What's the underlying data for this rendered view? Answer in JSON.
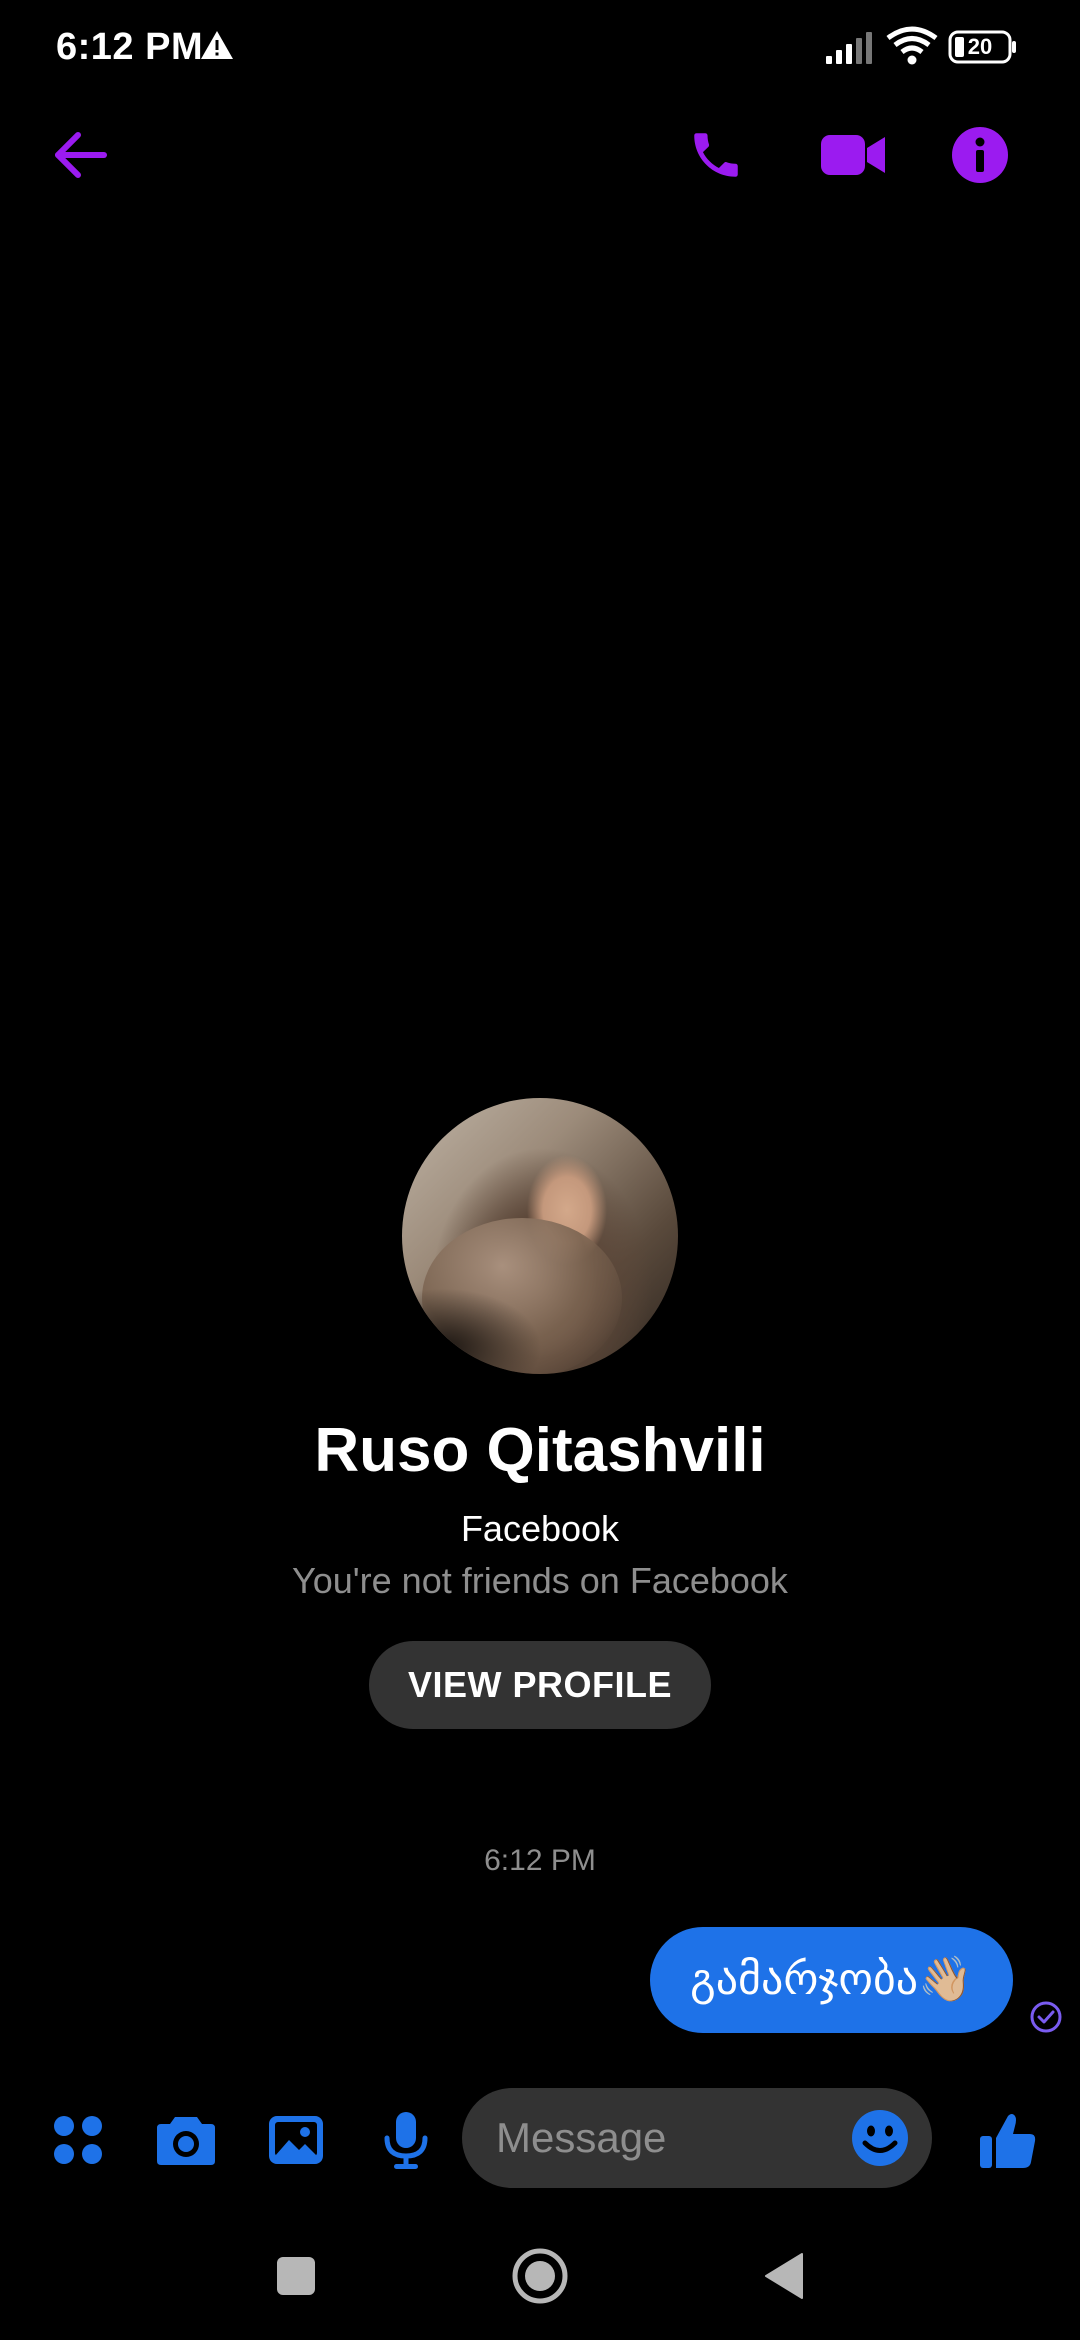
{
  "status_bar": {
    "time": "6:12 PM",
    "battery": "20",
    "icons": [
      "warning-icon",
      "signal-icon",
      "wifi-icon",
      "battery-icon"
    ]
  },
  "header": {
    "icons": [
      "back-arrow-icon",
      "phone-icon",
      "video-icon",
      "info-icon"
    ],
    "accent_color": "#9b1bf0"
  },
  "profile": {
    "name": "Ruso Qitashvili",
    "platform": "Facebook",
    "friend_status": "You're not friends on Facebook",
    "view_profile_label": "VIEW PROFILE"
  },
  "chat": {
    "timestamp": "6:12 PM",
    "messages": [
      {
        "text": "გამარჯობა👋🏼",
        "sender": "me",
        "bubble_color": "#1e72e8"
      }
    ]
  },
  "composer": {
    "placeholder": "Message",
    "icons": [
      "apps-icon",
      "camera-icon",
      "gallery-icon",
      "mic-icon",
      "emoji-icon",
      "thumbs-up-icon"
    ],
    "accent_color": "#1e72e8"
  },
  "nav_bar": {
    "icons": [
      "recents-square-icon",
      "home-circle-icon",
      "back-triangle-icon"
    ]
  }
}
